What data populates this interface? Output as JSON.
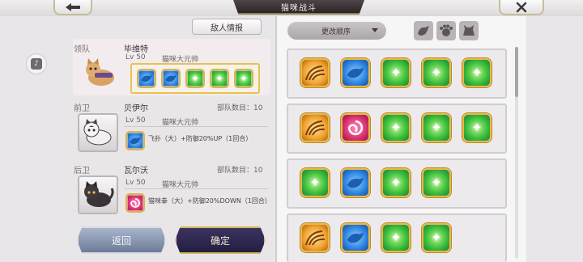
{
  "header": {
    "title": "猫咪战斗"
  },
  "left": {
    "enemy_info_label": "敌人情报",
    "leader": {
      "role": "领队",
      "name": "毕维特",
      "level": "Lv 50",
      "rank": "猫咪大元帅"
    },
    "front": {
      "role": "前卫",
      "name": "贝伊尔",
      "level": "Lv 50",
      "rank": "猫咪大元帅",
      "troops_label": "部队数目：10",
      "skill": "飞扑（大）+防御20%UP（1回合）"
    },
    "rear": {
      "role": "后卫",
      "name": "瓦尔沃",
      "level": "Lv 50",
      "rank": "猫咪大元帅",
      "troops_label": "部队数目：10",
      "skill": "猫咪拳（大）+防御20%DOWN（1回合）"
    },
    "back_label": "返回",
    "confirm_label": "确定"
  },
  "right": {
    "order_label": "更改顺序",
    "rows": [
      [
        "orange",
        "blue",
        "green",
        "green",
        "green"
      ],
      [
        "orange",
        "magenta",
        "green",
        "green",
        "green"
      ],
      [
        "green",
        "blue",
        "green",
        "green"
      ],
      [
        "orange",
        "blue",
        "green",
        "green"
      ]
    ]
  },
  "icons": {
    "back": "back-arrow-icon",
    "close": "close-x-icon",
    "side": "tiktok-icon",
    "filters": [
      "paw-filter-icon",
      "claw-filter-icon",
      "cat-filter-icon"
    ]
  },
  "colors": {
    "gold": "#e0b24a",
    "dark": "#2c2528"
  }
}
